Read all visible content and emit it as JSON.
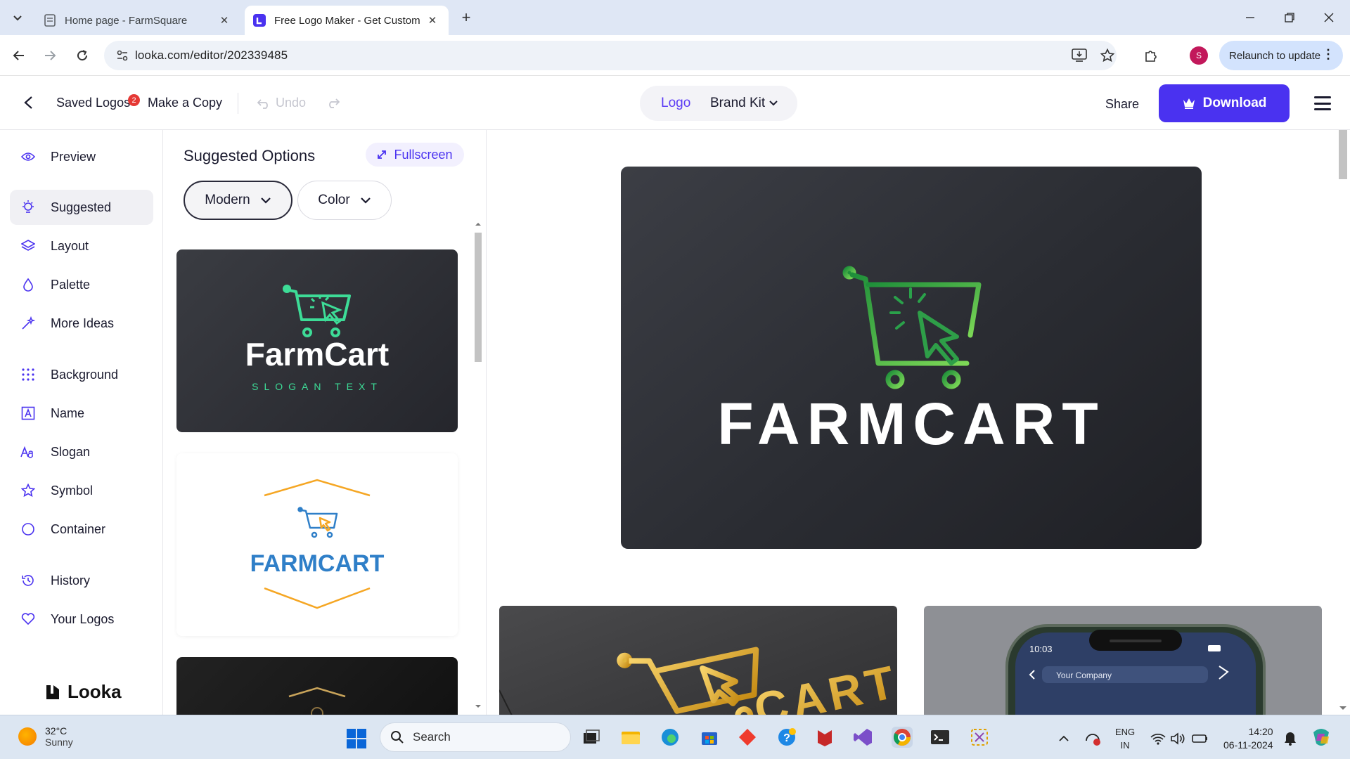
{
  "browser": {
    "tabs": [
      {
        "title": "Home page - FarmSquare",
        "active": false
      },
      {
        "title": "Free Logo Maker - Get Custom",
        "active": true
      }
    ],
    "url": "looka.com/editor/202339485",
    "relaunch_label": "Relaunch to update",
    "profile_initial": "S"
  },
  "header": {
    "saved_logos": "Saved Logos",
    "saved_badge": "2",
    "make_copy": "Make a Copy",
    "undo": "Undo",
    "seg_logo": "Logo",
    "seg_brand_kit": "Brand Kit",
    "share": "Share",
    "download": "Download"
  },
  "sidebar": {
    "items": [
      {
        "label": "Preview",
        "icon": "eye-icon"
      },
      {
        "label": "Suggested",
        "icon": "bulb-icon",
        "active": true
      },
      {
        "label": "Layout",
        "icon": "layers-icon"
      },
      {
        "label": "Palette",
        "icon": "drop-icon"
      },
      {
        "label": "More Ideas",
        "icon": "magic-icon"
      },
      {
        "label": "Background",
        "icon": "grid-icon"
      },
      {
        "label": "Name",
        "icon": "text-box-icon"
      },
      {
        "label": "Slogan",
        "icon": "font-icon"
      },
      {
        "label": "Symbol",
        "icon": "star-icon"
      },
      {
        "label": "Container",
        "icon": "circle-icon"
      },
      {
        "label": "History",
        "icon": "history-icon"
      },
      {
        "label": "Your Logos",
        "icon": "heart-icon"
      }
    ],
    "brand": "Looka"
  },
  "panel": {
    "title": "Suggested Options",
    "fullscreen": "Fullscreen",
    "filter_style": "Modern",
    "filter_color": "Color",
    "cards": [
      {
        "name": "FarmCart",
        "slogan": "SLOGAN TEXT"
      },
      {
        "name": "FARMCART"
      }
    ]
  },
  "canvas": {
    "logo_name": "FARMCART",
    "mock1_text": "CART",
    "phone_time": "10:03",
    "phone_search": "Your Company"
  },
  "taskbar": {
    "temp": "32°C",
    "weather": "Sunny",
    "search": "Search",
    "lang1": "ENG",
    "lang2": "IN",
    "time": "14:20",
    "date": "06-11-2024"
  },
  "colors": {
    "accent": "#4a32f0",
    "logo_green_light": "#7ed957",
    "logo_green_dark": "#1f8f3a",
    "card_teal": "#3ddc97",
    "hex_orange": "#f5a623",
    "farmcart_blue": "#2f7fc8"
  }
}
